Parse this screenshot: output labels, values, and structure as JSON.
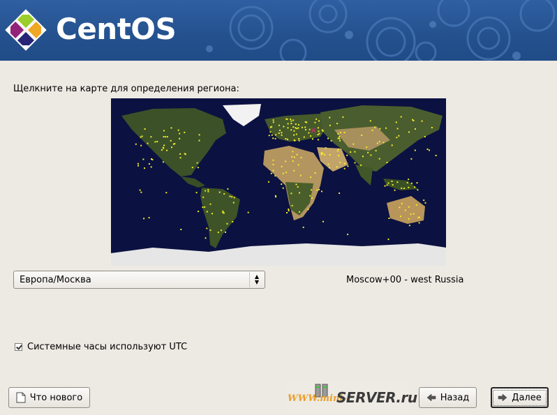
{
  "header": {
    "brand": "CentOS",
    "logo_icon": "centos-logo-icon",
    "background": "#2f5fa2"
  },
  "main": {
    "prompt": "Щелкните на карте для определения региона:",
    "map_icon": "world-map",
    "timezone": {
      "selected": "Европа/Москва",
      "description": "Moscow+00 - west Russia"
    },
    "utc_checkbox": {
      "label": "Системные часы используют UTC",
      "checked": true
    }
  },
  "footer": {
    "release_notes_label": "Что нового",
    "back_label": "Назад",
    "next_label": "Далее",
    "watermark_prefix": "WWW.mini-",
    "watermark_suffix": "SERVER.ru"
  }
}
